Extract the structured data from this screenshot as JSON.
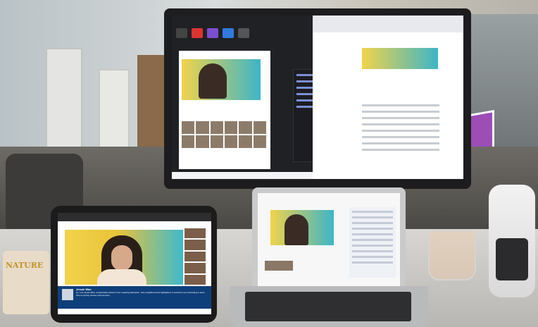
{
  "scene": {
    "tablet_caption": {
      "name": "Jessie Wan",
      "message": "Hi, I am Jessie Wan, an Education Advisor from Leapfrog Education. Very insightful points highlighted, it would be very interesting to learn how to portray service improvement."
    },
    "snack_brand": "NATURE",
    "colors": {
      "banner_yellow": "#f1d34a",
      "banner_teal": "#3db5c8",
      "caption_blue": "#0f3f7a",
      "monitor_bezel": "#1d1d1f"
    }
  }
}
